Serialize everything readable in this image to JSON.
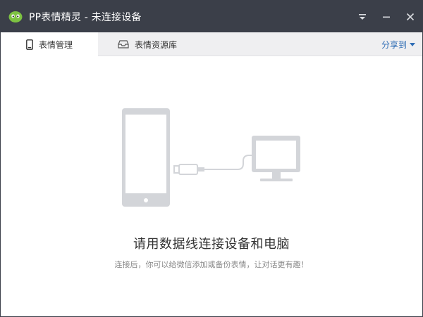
{
  "window": {
    "title": "PP表情精灵  -  未连接设备"
  },
  "tabs": [
    {
      "label": "表情管理",
      "icon": "phone-icon",
      "active": true
    },
    {
      "label": "表情资源库",
      "icon": "resource-box-icon",
      "active": false
    }
  ],
  "share": {
    "label": "分享到"
  },
  "empty_state": {
    "headline": "请用数据线连接设备和电脑",
    "hint": "连接后，你可以给微信添加或备份表情，让对话更有趣！"
  },
  "colors": {
    "titlebar_bg": "#3b3f49",
    "tab_bg": "#efeff1",
    "accent_link": "#2f6db5",
    "illustration": "#d3d5d9",
    "logo_green": "#7dc242"
  }
}
